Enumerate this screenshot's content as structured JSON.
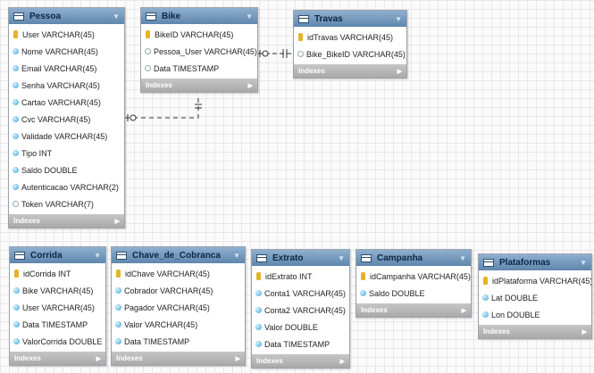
{
  "tables": [
    {
      "id": "pessoa",
      "name": "Pessoa",
      "indexes": "Indexes",
      "columns": [
        {
          "type": "key",
          "text": "User VARCHAR(45)"
        },
        {
          "type": "col",
          "text": "Nome VARCHAR(45)"
        },
        {
          "type": "col",
          "text": "Email VARCHAR(45)"
        },
        {
          "type": "col",
          "text": "Senha VARCHAR(45)"
        },
        {
          "type": "col",
          "text": "Cartao VARCHAR(45)"
        },
        {
          "type": "col",
          "text": "Cvc VARCHAR(45)"
        },
        {
          "type": "col",
          "text": "Validade VARCHAR(45)"
        },
        {
          "type": "col",
          "text": "Tipo INT"
        },
        {
          "type": "col",
          "text": "Saldo DOUBLE"
        },
        {
          "type": "col",
          "text": "Autenticacao VARCHAR(2)"
        },
        {
          "type": "opt",
          "text": "Token VARCHAR(7)"
        }
      ]
    },
    {
      "id": "bike",
      "name": "Bike",
      "indexes": "Indexes",
      "columns": [
        {
          "type": "key",
          "text": "BikeID VARCHAR(45)"
        },
        {
          "type": "opt",
          "text": "Pessoa_User VARCHAR(45)"
        },
        {
          "type": "opt",
          "text": "Data TIMESTAMP"
        }
      ]
    },
    {
      "id": "travas",
      "name": "Travas",
      "indexes": "Indexes",
      "columns": [
        {
          "type": "key",
          "text": "idTravas VARCHAR(45)"
        },
        {
          "type": "opt",
          "text": "Bike_BikeID VARCHAR(45)"
        }
      ]
    },
    {
      "id": "corrida",
      "name": "Corrida",
      "indexes": "Indexes",
      "columns": [
        {
          "type": "key",
          "text": "idCorrida INT"
        },
        {
          "type": "col",
          "text": "Bike VARCHAR(45)"
        },
        {
          "type": "col",
          "text": "User VARCHAR(45)"
        },
        {
          "type": "col",
          "text": "Data TIMESTAMP"
        },
        {
          "type": "col",
          "text": "ValorCorrida DOUBLE"
        }
      ]
    },
    {
      "id": "chave",
      "name": "Chave_de_Cobranca",
      "indexes": "Indexes",
      "columns": [
        {
          "type": "key",
          "text": "idChave VARCHAR(45)"
        },
        {
          "type": "col",
          "text": "Cobrador VARCHAR(45)"
        },
        {
          "type": "col",
          "text": "Pagador VARCHAR(45)"
        },
        {
          "type": "col",
          "text": "Valor VARCHAR(45)"
        },
        {
          "type": "col",
          "text": "Data TIMESTAMP"
        }
      ]
    },
    {
      "id": "extrato",
      "name": "Extrato",
      "indexes": "Indexes",
      "columns": [
        {
          "type": "key",
          "text": "idExtrato INT"
        },
        {
          "type": "col",
          "text": "Conta1 VARCHAR(45)"
        },
        {
          "type": "col",
          "text": "Conta2 VARCHAR(45)"
        },
        {
          "type": "col",
          "text": "Valor DOUBLE"
        },
        {
          "type": "col",
          "text": "Data TIMESTAMP"
        }
      ]
    },
    {
      "id": "campanha",
      "name": "Campanha",
      "indexes": "Indexes",
      "columns": [
        {
          "type": "key",
          "text": "idCampanha VARCHAR(45)"
        },
        {
          "type": "col",
          "text": "Saldo DOUBLE"
        }
      ]
    },
    {
      "id": "plataformas",
      "name": "Plataformas",
      "indexes": "Indexes",
      "columns": [
        {
          "type": "key",
          "text": "idPlataforma VARCHAR(45)"
        },
        {
          "type": "col",
          "text": "Lat DOUBLE"
        },
        {
          "type": "col",
          "text": "Lon DOUBLE"
        }
      ]
    }
  ],
  "relationships": [
    {
      "from": "bike",
      "to": "pessoa",
      "style": "dashed"
    },
    {
      "from": "travas",
      "to": "bike",
      "style": "dashed"
    }
  ]
}
